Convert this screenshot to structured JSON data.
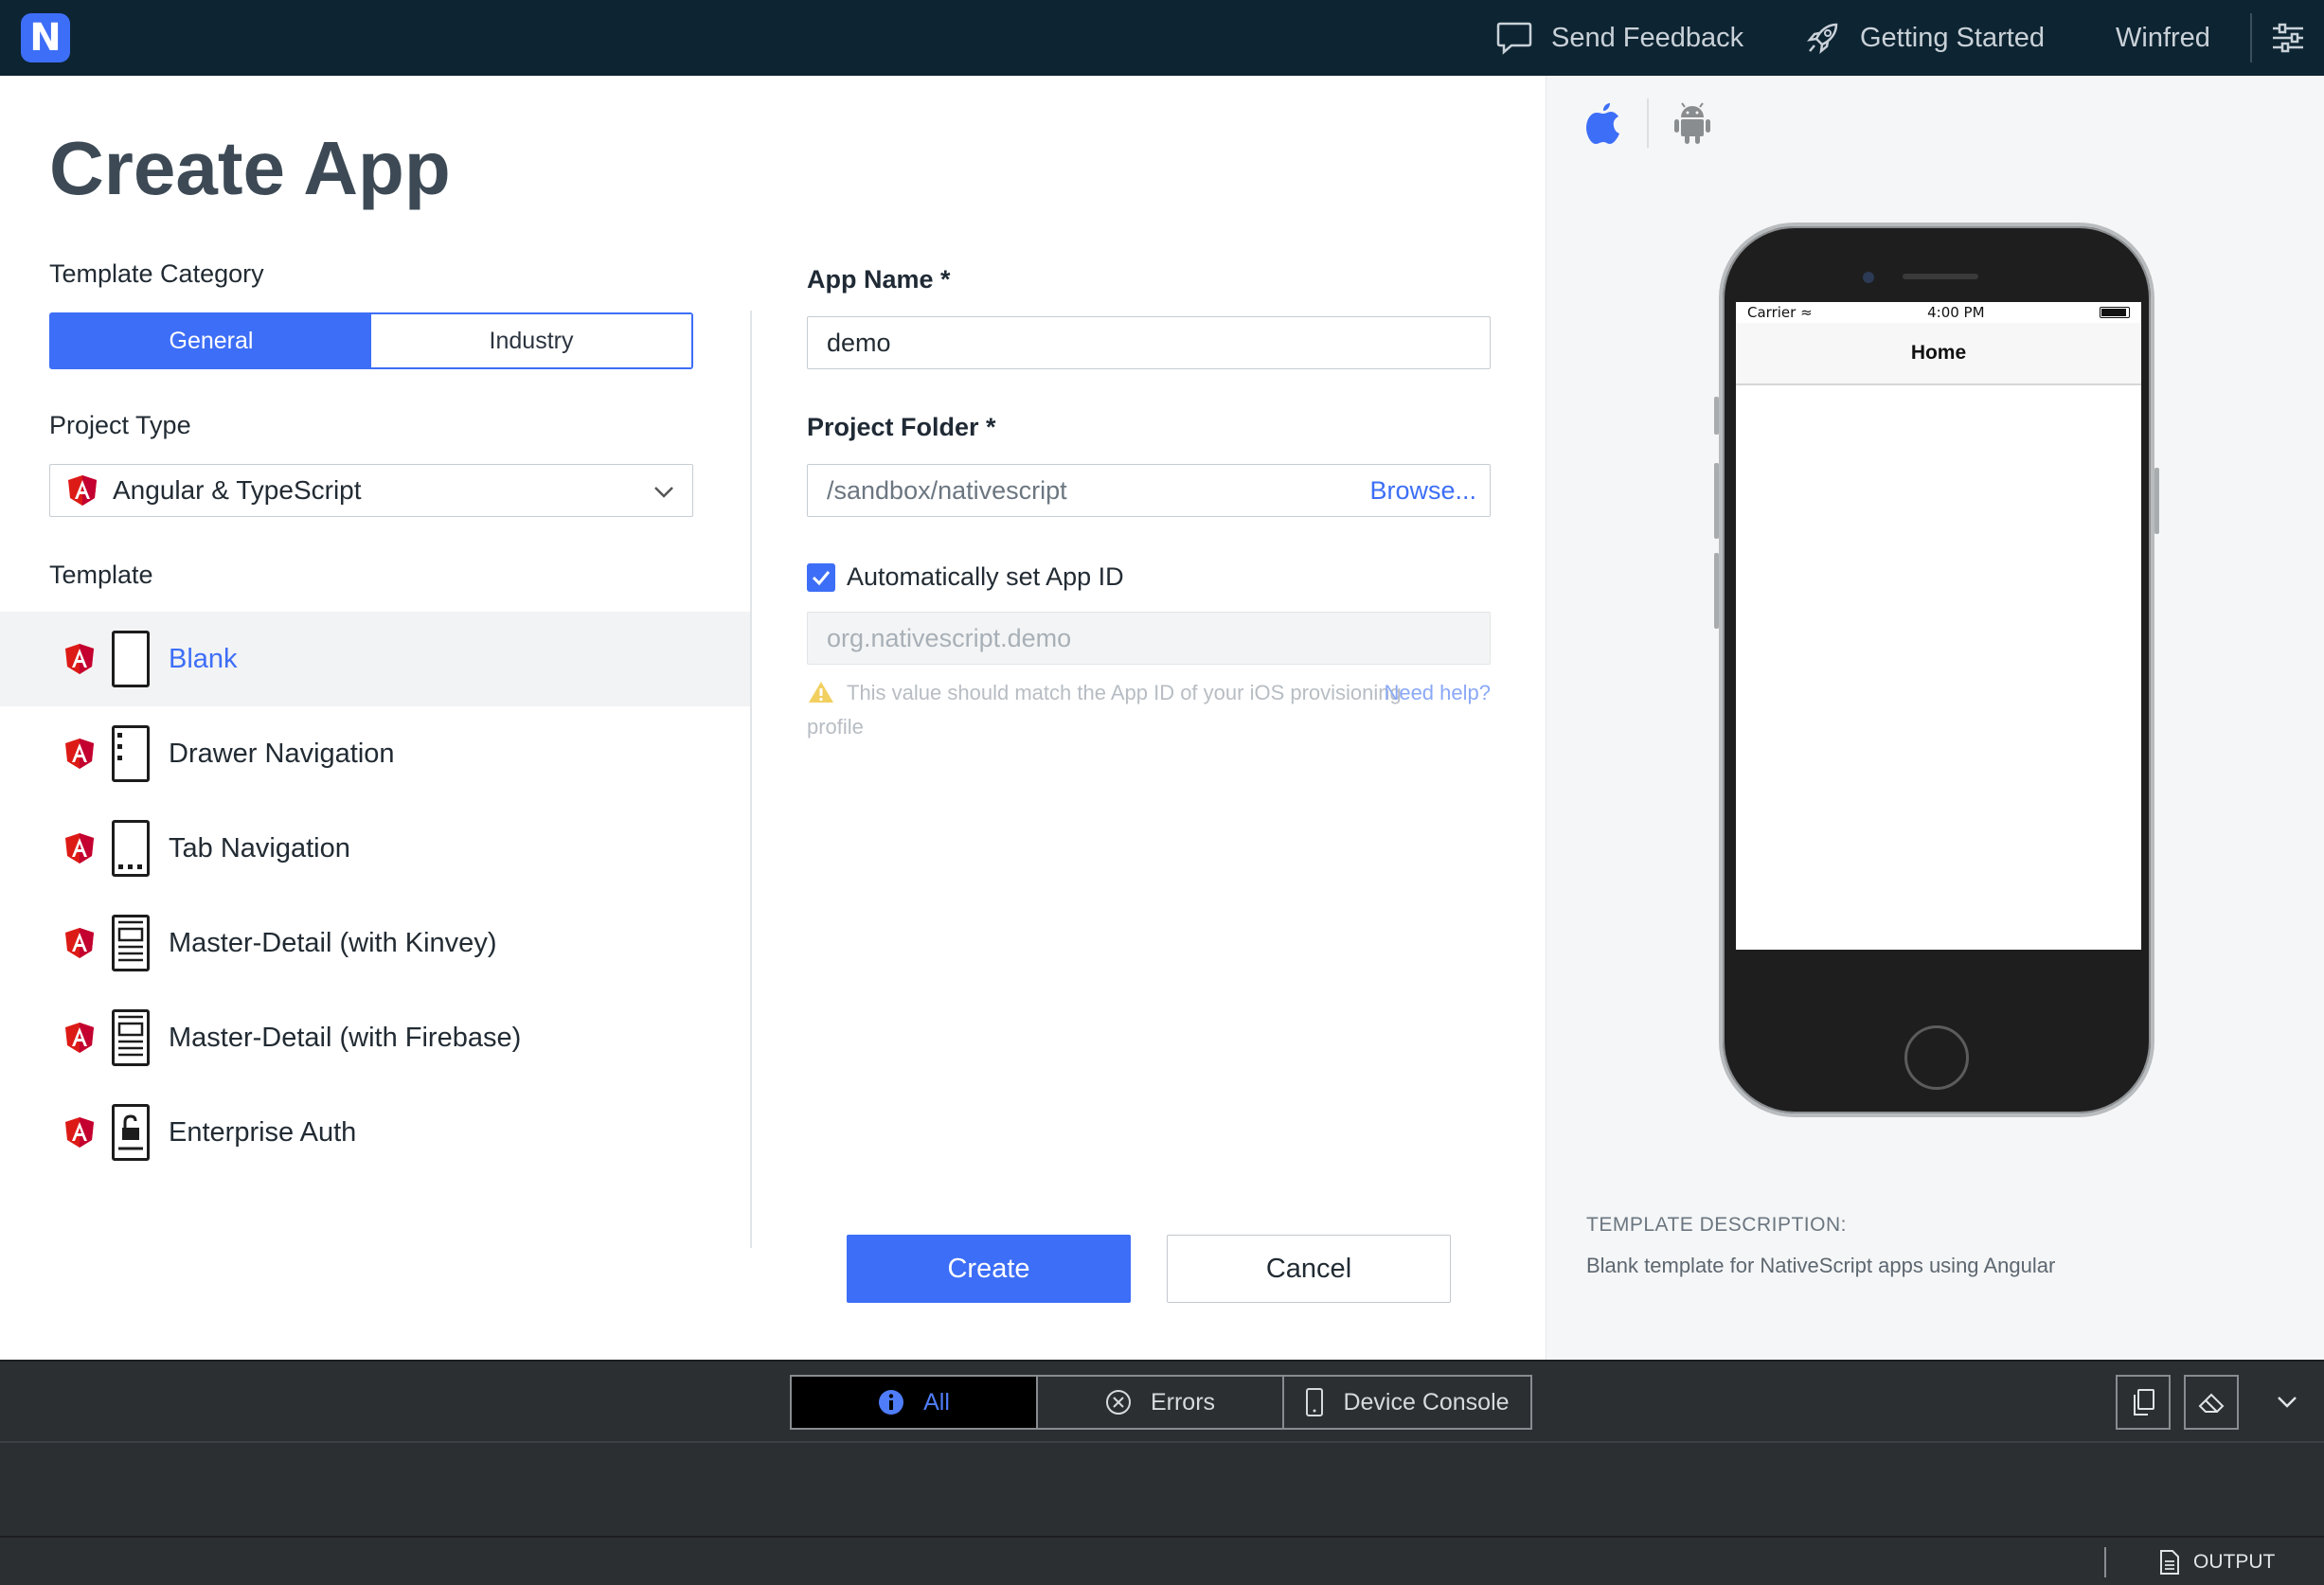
{
  "topbar": {
    "logo_letter": "N",
    "send_feedback": "Send Feedback",
    "getting_started": "Getting Started",
    "user": "Winfred"
  },
  "page": {
    "title": "Create App"
  },
  "template_category": {
    "label": "Template Category",
    "options": [
      "General",
      "Industry"
    ],
    "selected": "General"
  },
  "project_type": {
    "label": "Project Type",
    "value": "Angular & TypeScript"
  },
  "templates": {
    "label": "Template",
    "items": [
      {
        "name": "Blank",
        "thumb": "blank",
        "selected": true
      },
      {
        "name": "Drawer Navigation",
        "thumb": "drawer"
      },
      {
        "name": "Tab Navigation",
        "thumb": "tabs"
      },
      {
        "name": "Master-Detail (with Kinvey)",
        "thumb": "master-detail"
      },
      {
        "name": "Master-Detail (with Firebase)",
        "thumb": "master-detail"
      },
      {
        "name": "Enterprise Auth",
        "thumb": "lock"
      }
    ]
  },
  "form": {
    "app_name_label": "App Name *",
    "app_name_value": "demo",
    "project_folder_label": "Project Folder *",
    "project_folder_value": "/sandbox/nativescript",
    "browse_label": "Browse...",
    "auto_app_id_label": "Automatically set App ID",
    "auto_app_id_checked": true,
    "app_id_value": "org.nativescript.demo",
    "warning_text": "This value should match the App ID of your iOS provisioning profile",
    "need_help": "Need help?",
    "create_label": "Create",
    "cancel_label": "Cancel"
  },
  "preview": {
    "platforms": [
      "apple-icon",
      "android-icon"
    ],
    "selected_platform": "ios",
    "status_carrier": "Carrier",
    "status_time": "4:00 PM",
    "nav_title": "Home",
    "description_title": "TEMPLATE DESCRIPTION:",
    "description_text": "Blank template for NativeScript apps using Angular"
  },
  "console": {
    "tabs": [
      "All",
      "Errors",
      "Device Console"
    ],
    "active_tab": "All",
    "output_label": "OUTPUT"
  },
  "colors": {
    "accent": "#3d6ef7",
    "topbar": "#0d2432",
    "console": "#2c2f32",
    "angular_red": "#dd1b16"
  }
}
